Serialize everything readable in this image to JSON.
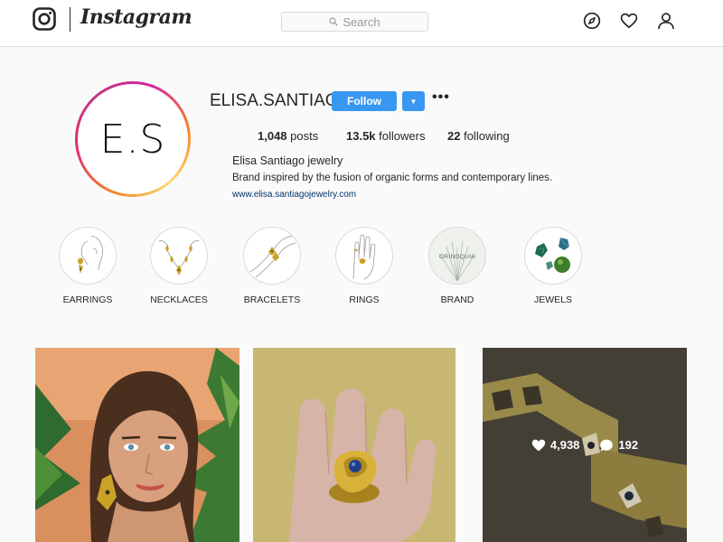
{
  "nav": {
    "brand": "Instagram",
    "search_placeholder": "Search"
  },
  "profile": {
    "username": "ELISA.SANTIAGO",
    "avatar_text": "E.S",
    "follow_label": "Follow",
    "dropdown_glyph": "▼",
    "more_glyph": "•••",
    "stats": {
      "posts_count": "1,048",
      "posts_label": "posts",
      "followers_count": "13.5k",
      "followers_label": "followers",
      "following_count": "22",
      "following_label": "following"
    },
    "full_name": "Elisa Santiago jewelry",
    "bio": "Brand inspired by the fusion of organic forms and contemporary lines.",
    "website": "www.elisa.santiagojewelry.com"
  },
  "highlights": [
    {
      "label": "EARRINGS"
    },
    {
      "label": "NECKLACES"
    },
    {
      "label": "BRACELETS"
    },
    {
      "label": "RINGS"
    },
    {
      "label": "BRAND",
      "thumb_text": "ORINOQUIA"
    },
    {
      "label": "JEWELS"
    }
  ],
  "posts": {
    "hover": {
      "likes": "4,938",
      "comments": "192"
    }
  },
  "colors": {
    "follow_blue": "#3897f0",
    "link_blue": "#003569",
    "border": "#dbdbdb"
  },
  "icons": [
    "instagram-glyph-icon",
    "search-icon",
    "compass-icon",
    "heart-icon",
    "user-icon",
    "chevron-down-icon",
    "more-icon",
    "comment-icon"
  ]
}
